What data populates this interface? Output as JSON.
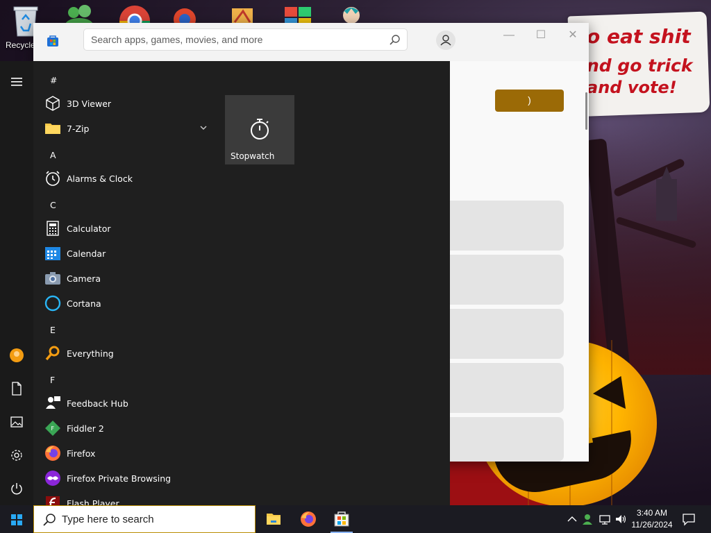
{
  "desktop": {
    "icons": [
      {
        "name": "recycle-bin",
        "label": "Recycle"
      }
    ],
    "wallpaper_text": [
      "o eat shit",
      "nd go trick",
      "and vote!"
    ]
  },
  "store_window": {
    "search_placeholder": "Search apps, games, movies, and more",
    "controls": {
      "minimize": "—",
      "maximize": "☐",
      "close": "✕"
    },
    "accent_button_text": ")",
    "accent_color": "#9b6a06"
  },
  "start_menu": {
    "sections": [
      {
        "letter": "#",
        "apps": [
          "3D Viewer",
          "7-Zip"
        ]
      },
      {
        "letter": "A",
        "apps": [
          "Alarms & Clock"
        ]
      },
      {
        "letter": "C",
        "apps": [
          "Calculator",
          "Calendar",
          "Camera",
          "Cortana"
        ]
      },
      {
        "letter": "E",
        "apps": [
          "Everything"
        ]
      },
      {
        "letter": "F",
        "apps": [
          "Feedback Hub",
          "Fiddler 2",
          "Firefox",
          "Firefox Private Browsing",
          "Flash Player"
        ]
      }
    ],
    "pinned_tile": {
      "label": "Stopwatch",
      "icon": "stopwatch-icon"
    }
  },
  "taskbar": {
    "search_placeholder": "Type here to search",
    "pinned_apps": [
      "file-explorer",
      "firefox",
      "microsoft-store"
    ],
    "clock_time": "3:40 AM",
    "clock_date": "11/26/2024"
  }
}
